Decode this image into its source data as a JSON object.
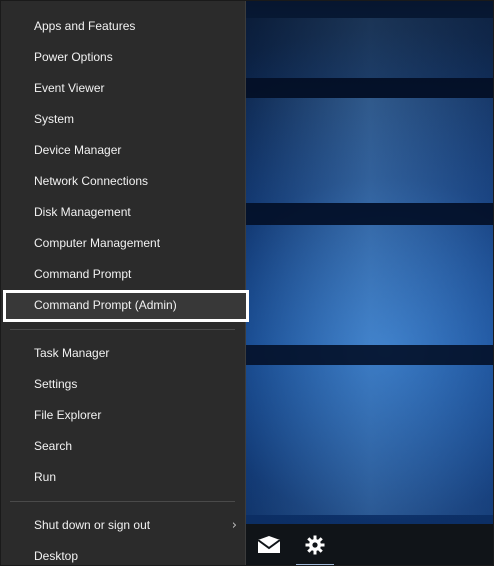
{
  "menu": {
    "items_top": [
      {
        "label": "Apps and Features"
      },
      {
        "label": "Power Options"
      },
      {
        "label": "Event Viewer"
      },
      {
        "label": "System"
      },
      {
        "label": "Device Manager"
      },
      {
        "label": "Network Connections"
      },
      {
        "label": "Disk Management"
      },
      {
        "label": "Computer Management"
      },
      {
        "label": "Command Prompt"
      },
      {
        "label": "Command Prompt (Admin)"
      }
    ],
    "items_middle": [
      {
        "label": "Task Manager"
      },
      {
        "label": "Settings"
      },
      {
        "label": "File Explorer"
      },
      {
        "label": "Search"
      },
      {
        "label": "Run"
      }
    ],
    "items_bottom": [
      {
        "label": "Shut down or sign out",
        "submenu": true
      },
      {
        "label": "Desktop"
      }
    ],
    "highlighted_item": "Command Prompt (Admin)",
    "chevron": "›"
  },
  "taskbar": {
    "icons": [
      "mail-icon",
      "gear-icon"
    ],
    "active_icon": "gear-icon"
  },
  "colors": {
    "menu_bg": "#2b2b2b",
    "menu_text": "#f2f2f2",
    "highlight_border": "#ffffff",
    "taskbar_bg": "#101418"
  }
}
